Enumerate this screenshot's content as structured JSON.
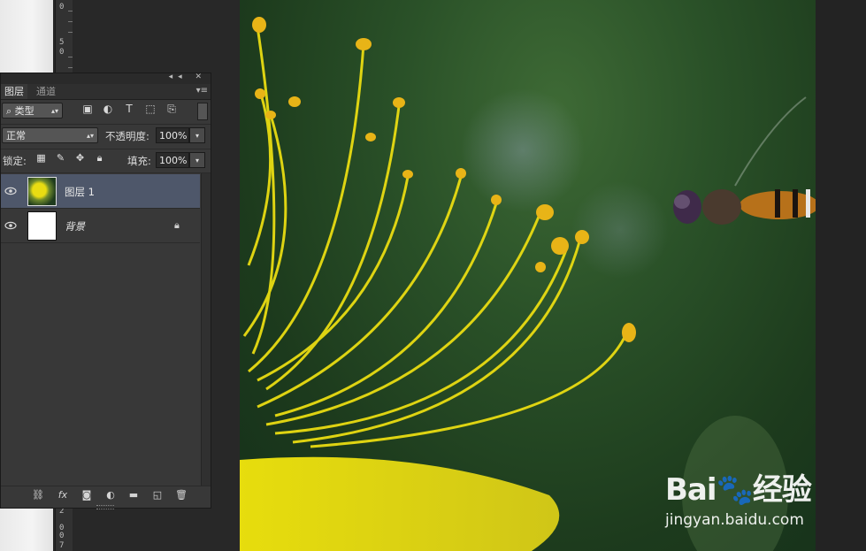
{
  "ruler": {
    "ticks": [
      "0",
      "5",
      "0",
      "2",
      "0",
      "0",
      "7"
    ]
  },
  "panel": {
    "tabs": [
      {
        "label": "图层"
      },
      {
        "label": "通道"
      }
    ],
    "filter": {
      "label": "类型"
    },
    "blend_mode": "正常",
    "opacity": {
      "label": "不透明度:",
      "value": "100%"
    },
    "lock": {
      "label": "锁定:"
    },
    "fill": {
      "label": "填充:",
      "value": "100%"
    },
    "layers": [
      {
        "name": "图层 1",
        "selected": true,
        "visible": true
      },
      {
        "name": "背景",
        "selected": false,
        "visible": true,
        "locked": true
      }
    ],
    "bottom_icons": [
      "link-icon",
      "fx-icon",
      "mask-icon",
      "adjustment-icon",
      "folder-icon",
      "new-layer-icon",
      "trash-icon"
    ],
    "bottom_fx_label": "fx"
  },
  "watermark": {
    "logo": "Bai🐾经验",
    "url": "jingyan.baidu.com"
  },
  "colors": {
    "panel_bg": "#383838",
    "selected_layer": "#4e576a",
    "stamen": "#f0df1a"
  }
}
